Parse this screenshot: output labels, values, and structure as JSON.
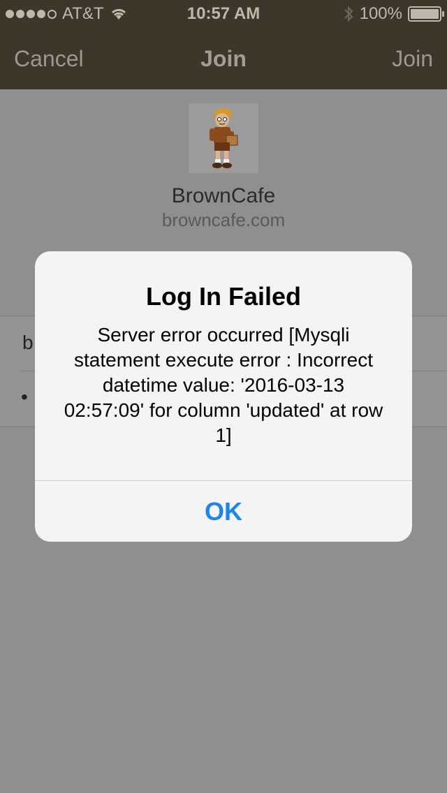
{
  "status_bar": {
    "carrier": "AT&T",
    "time": "10:57 AM",
    "battery": "100%",
    "battery_level": 1.0,
    "signal_bars_filled": 4,
    "signal_bars_total": 5
  },
  "nav": {
    "cancel_label": "Cancel",
    "title": "Join",
    "join_label": "Join"
  },
  "app": {
    "name": "BrownCafe",
    "url": "browncafe.com"
  },
  "form": {
    "username_value_partial": "b",
    "password_value_partial": "•"
  },
  "alert": {
    "title": "Log In Failed",
    "message": "Server error occurred [Mysqli statement execute error : Incorrect datetime value: '2016-03-13 02:57:09' for column 'updated' at row 1]",
    "ok_label": "OK"
  },
  "colors": {
    "nav_bg": "#3f362a",
    "accent": "#1a84f4"
  }
}
